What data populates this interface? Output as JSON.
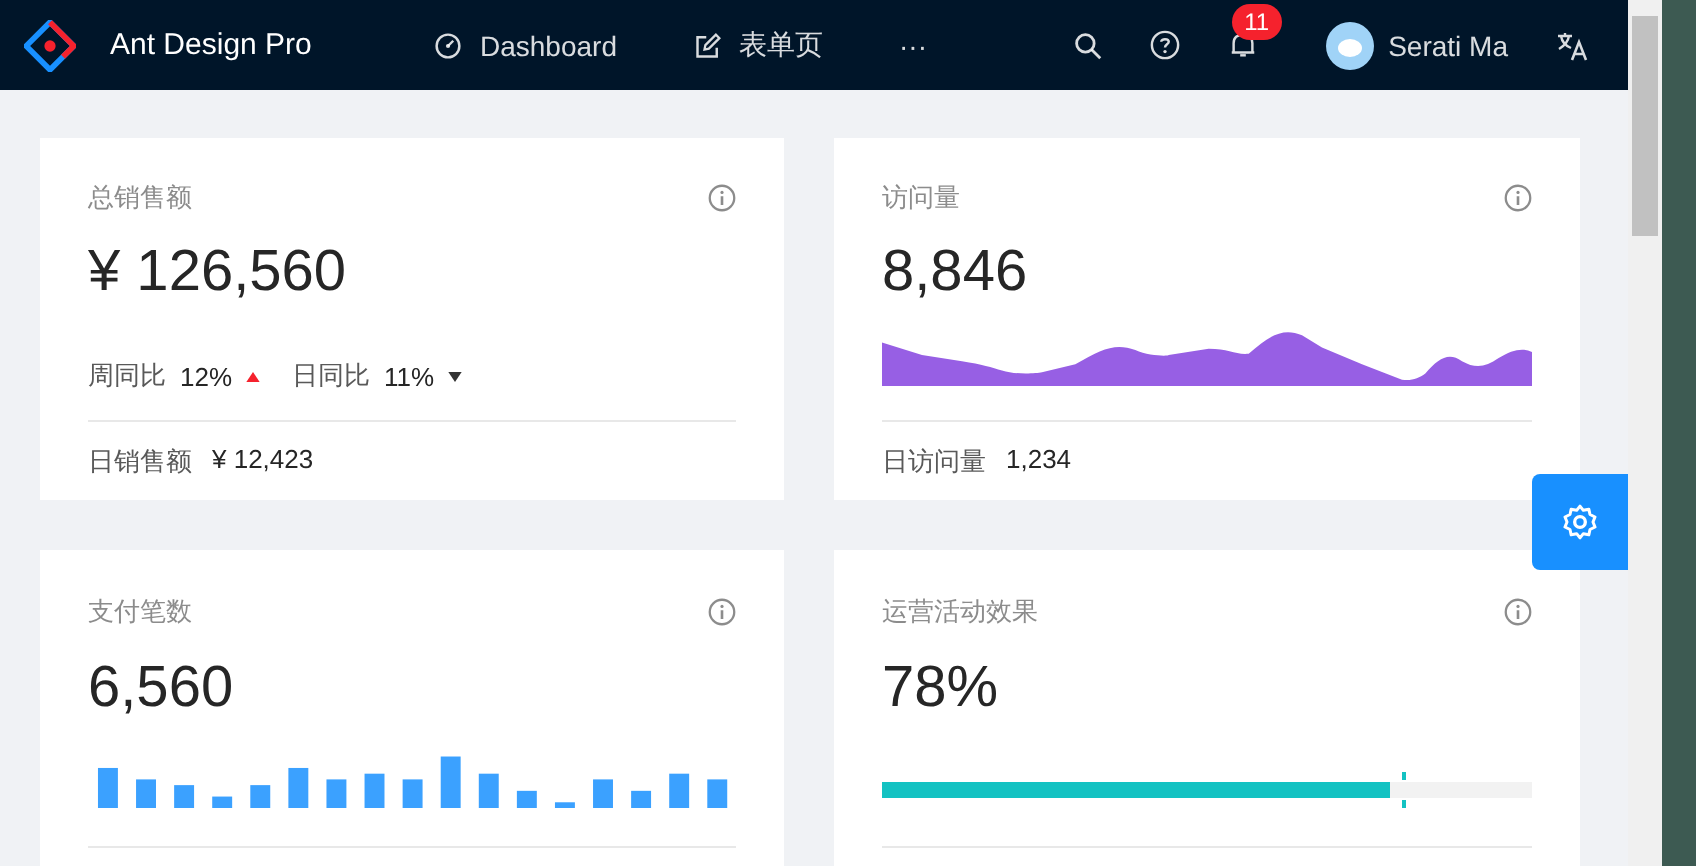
{
  "header": {
    "logo_text": "Ant Design Pro",
    "menu": [
      {
        "label": "Dashboard"
      },
      {
        "label": "表单页"
      },
      {
        "label": "···"
      }
    ],
    "notification_count": "11",
    "user_name": "Serati Ma"
  },
  "cards": [
    {
      "kind": "trend",
      "title": "总销售额",
      "value": "¥ 126,560",
      "trends": [
        {
          "label": "周同比",
          "value": "12%",
          "kind": "up"
        },
        {
          "label": "日同比",
          "value": "11%",
          "kind": "down"
        }
      ],
      "footer_label": "日销售额",
      "footer_value": "¥ 12,423"
    },
    {
      "kind": "area",
      "title": "访问量",
      "value": "8,846",
      "footer_label": "日访问量",
      "footer_value": "1,234"
    },
    {
      "kind": "bar",
      "title": "支付笔数",
      "value": "6,560"
    },
    {
      "kind": "progress",
      "title": "运营活动效果",
      "value": "78%",
      "level": 0.78
    }
  ]
}
